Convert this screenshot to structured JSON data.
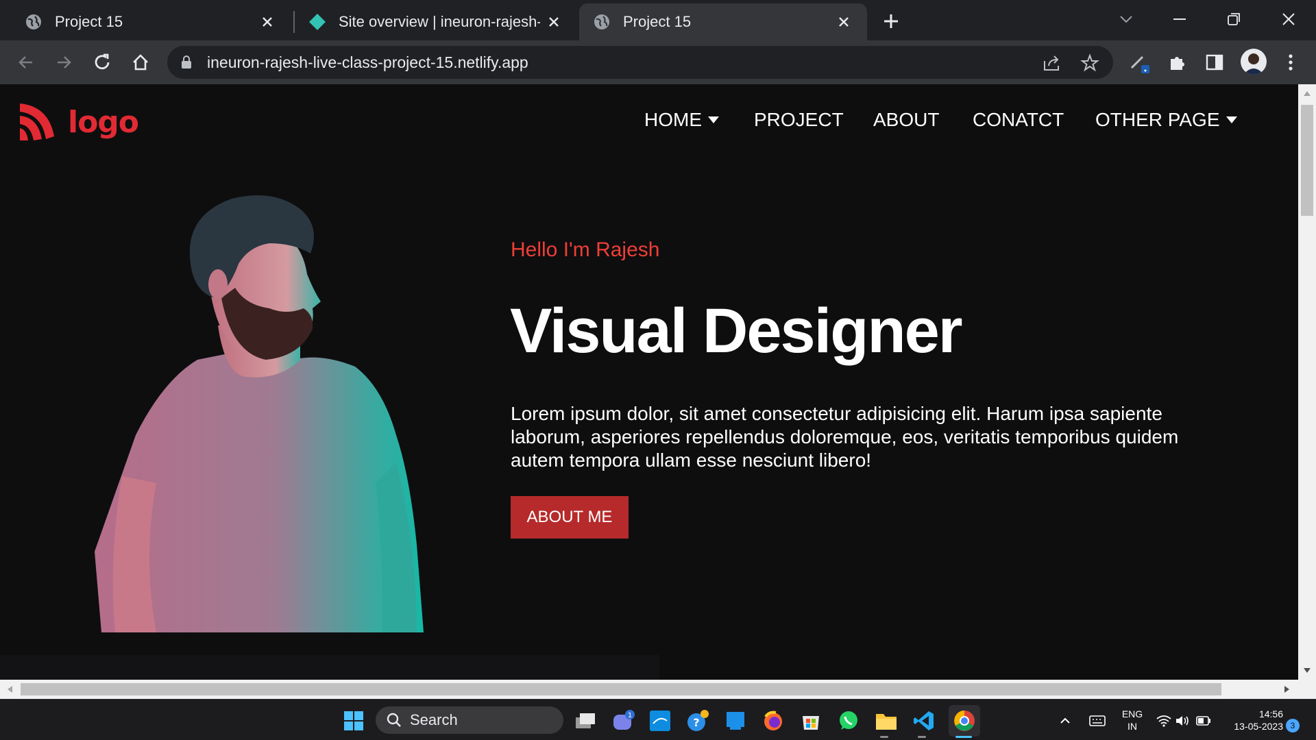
{
  "browser": {
    "tabs": [
      {
        "title": "Project 15",
        "favicon": "globe-icon",
        "active": false
      },
      {
        "title": "Site overview | ineuron-rajesh-live-class-project-15",
        "favicon": "netlify-icon",
        "active": false
      },
      {
        "title": "Project 15",
        "favicon": "globe-icon",
        "active": true
      }
    ],
    "url": "ineuron-rajesh-live-class-project-15.netlify.app"
  },
  "site": {
    "logo_text": "logo",
    "nav": [
      {
        "label": "HOME",
        "dropdown": true
      },
      {
        "label": "PROJECT",
        "dropdown": false
      },
      {
        "label": "ABOUT",
        "dropdown": false
      },
      {
        "label": "CONATCT",
        "dropdown": false
      },
      {
        "label": "OTHER PAGE",
        "dropdown": true
      }
    ],
    "hero": {
      "greeting": "Hello I'm Rajesh",
      "headline": "Visual Designer",
      "body": "Lorem ipsum dolor, sit amet consectetur adipisicing elit. Harum ipsa sapiente laborum, asperiores repellendus doloremque, eos, veritatis temporibus quidem autem tempora ullam esse nesciunt libero!",
      "button_label": "ABOUT ME"
    }
  },
  "taskbar": {
    "search_label": "Search",
    "language": "ENG",
    "region": "IN",
    "time": "14:56",
    "date": "13-05-2023",
    "notification_count": "3",
    "teams_badge": "1"
  },
  "colors": {
    "accent_red": "#ef3e36",
    "button_red": "#b62a2b",
    "page_bg": "#0e0e0f"
  }
}
